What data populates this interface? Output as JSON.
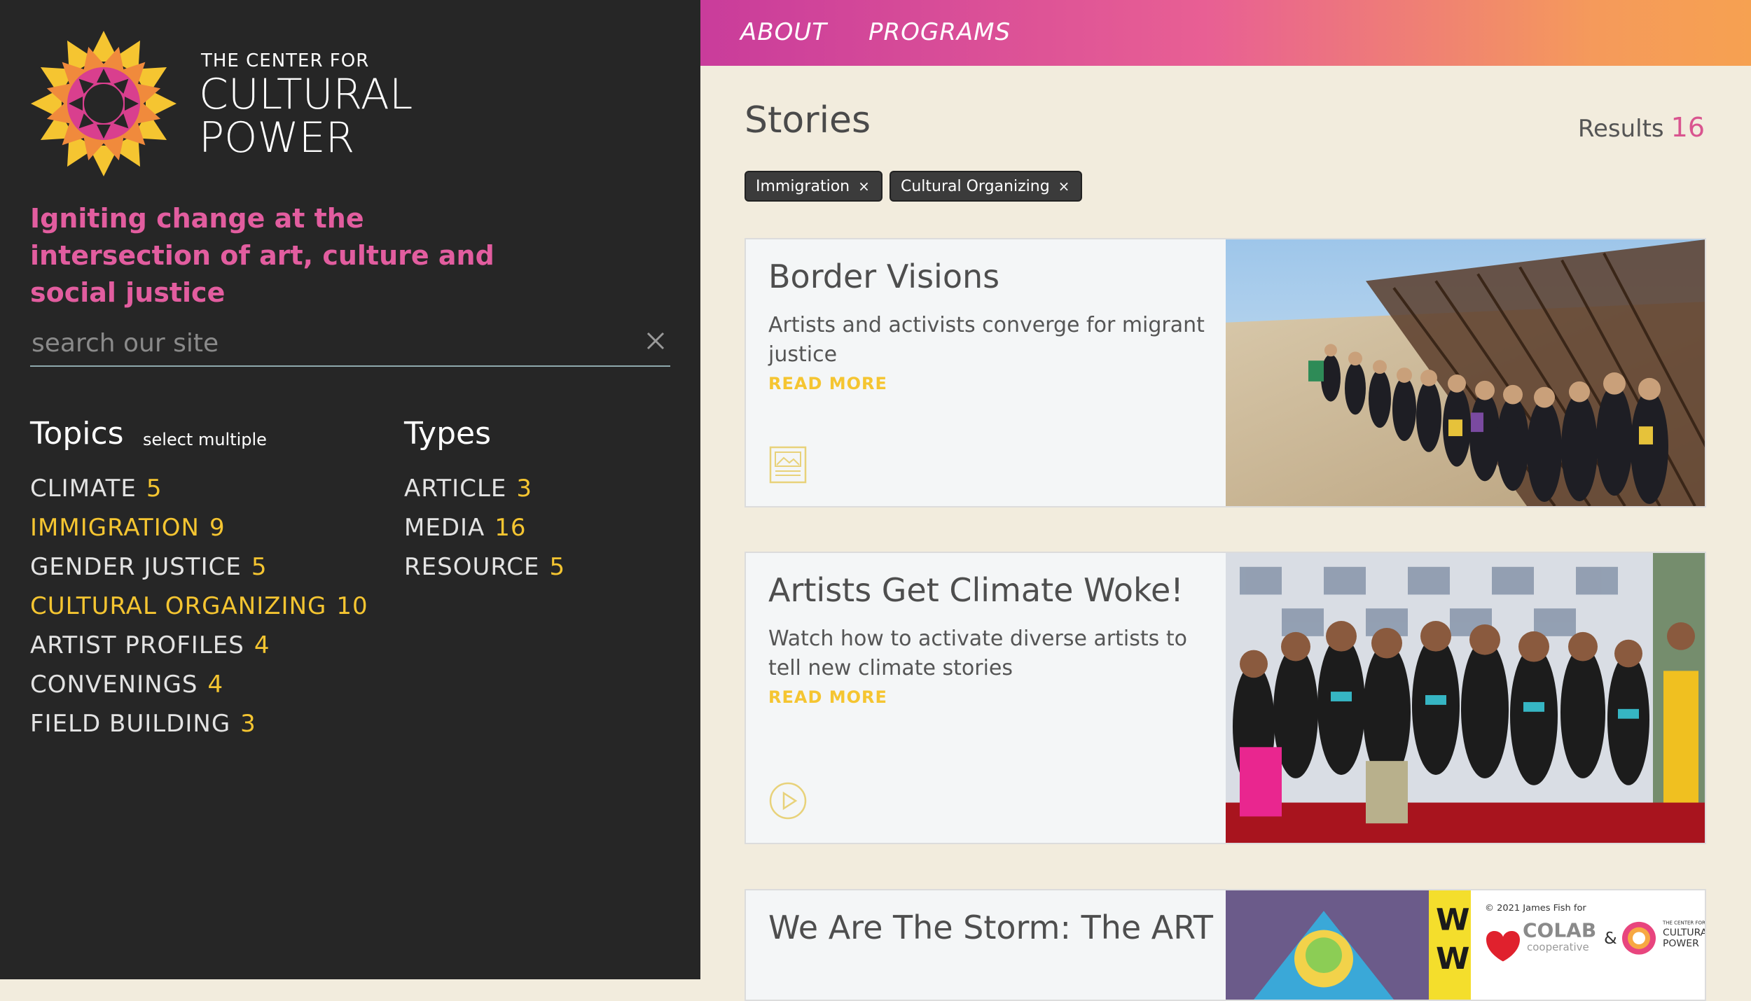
{
  "brand": {
    "small": "THE CENTER FOR",
    "line1": "CULTURAL",
    "line2": "POWER",
    "tagline": "Igniting change at the intersection of art, culture and social justice",
    "colors": {
      "pink": "#e25d9f",
      "yellow": "#f5c531",
      "sidebar": "#262626"
    }
  },
  "search": {
    "placeholder": "search our site",
    "value": ""
  },
  "topics": {
    "title": "Topics",
    "hint": "select multiple",
    "items": [
      {
        "label": "CLIMATE",
        "count": "5",
        "active": false
      },
      {
        "label": "IMMIGRATION",
        "count": "9",
        "active": true
      },
      {
        "label": "GENDER JUSTICE",
        "count": "5",
        "active": false
      },
      {
        "label": "CULTURAL ORGANIZING",
        "count": "10",
        "active": true
      },
      {
        "label": "ARTIST PROFILES",
        "count": "4",
        "active": false
      },
      {
        "label": "CONVENINGS",
        "count": "4",
        "active": false
      },
      {
        "label": "FIELD BUILDING",
        "count": "3",
        "active": false
      }
    ]
  },
  "types": {
    "title": "Types",
    "items": [
      {
        "label": "ARTICLE",
        "count": "3"
      },
      {
        "label": "MEDIA",
        "count": "16"
      },
      {
        "label": "RESOURCE",
        "count": "5"
      }
    ]
  },
  "nav": {
    "about": "ABOUT",
    "programs": "PROGRAMS"
  },
  "main": {
    "title": "Stories",
    "results_label": "Results",
    "results_count": "16",
    "chips": [
      {
        "label": "Immigration",
        "close": "×"
      },
      {
        "label": "Cultural Organizing",
        "close": "×"
      }
    ]
  },
  "stories": [
    {
      "title": "Border Visions",
      "desc": "Artists and activists converge for migrant justice",
      "read_more": "READ MORE",
      "icon": "article-icon"
    },
    {
      "title": "Artists Get Climate Woke!",
      "desc": "Watch how to activate diverse artists to tell new climate stories",
      "read_more": "READ MORE",
      "icon": "play-icon"
    },
    {
      "title": "We Are The Storm: The ART",
      "desc": "",
      "read_more": "",
      "icon": ""
    }
  ],
  "card3_image": {
    "credit": "© 2021 James Fish for",
    "colab": "COLAB",
    "colab_sub": "cooperative",
    "amp": "&",
    "ccp_small": "THE CENTER FOR",
    "ccp_line1": "CULTURAL",
    "ccp_line2": "POWER",
    "poster_text1": "WHY",
    "poster_text2": "WE"
  }
}
